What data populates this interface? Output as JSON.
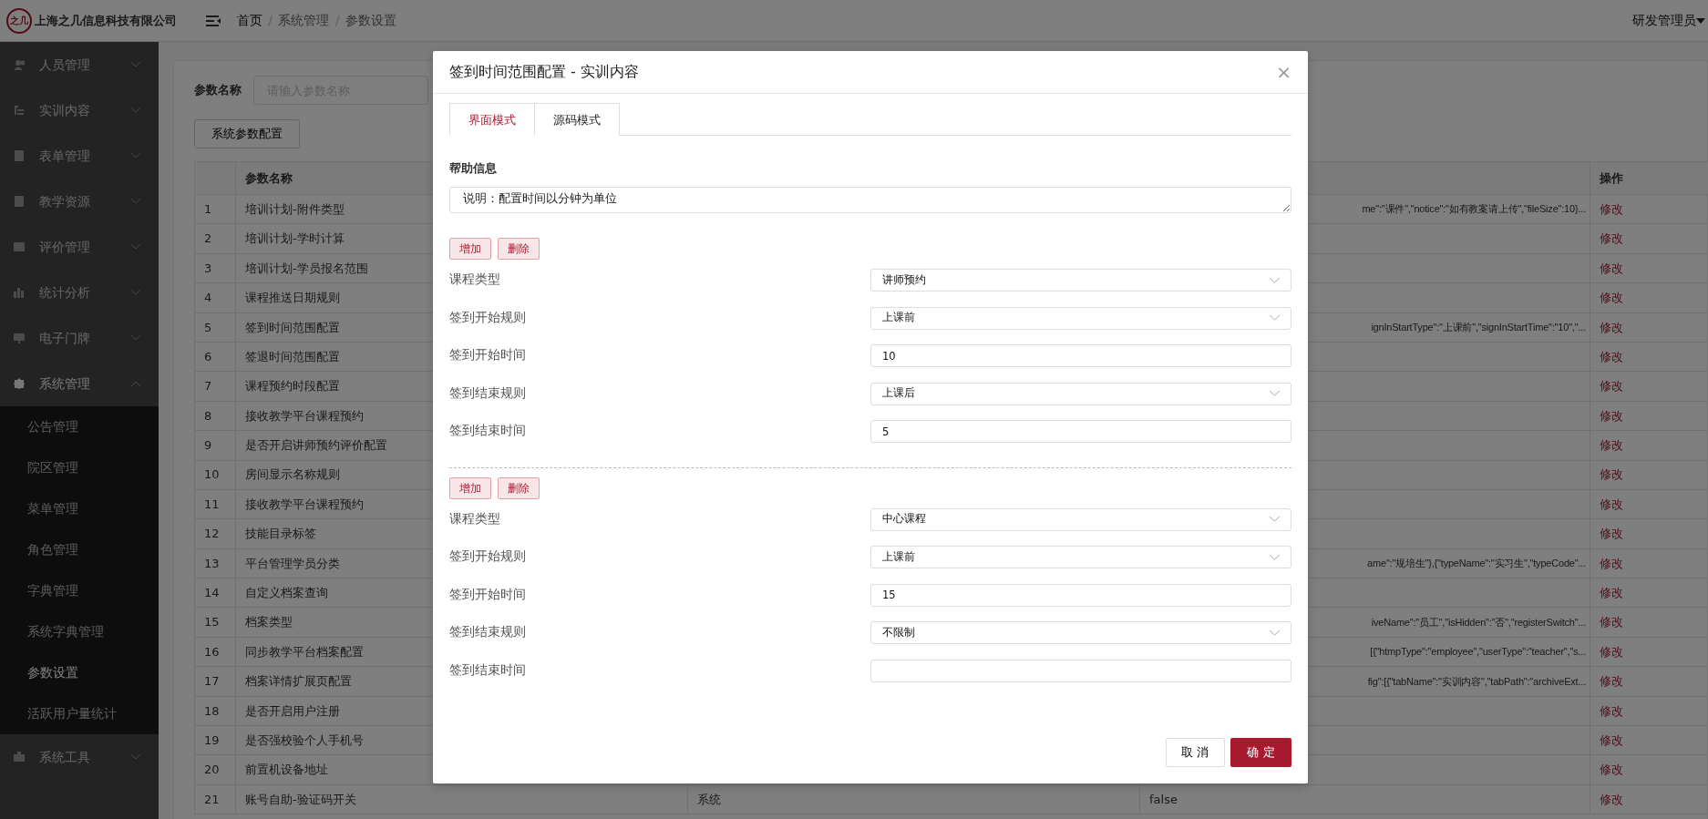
{
  "header": {
    "logo_text": "之几",
    "company": "上海之几信息科技有限公司",
    "breadcrumb": [
      {
        "kind": "link",
        "text": "首页"
      },
      {
        "kind": "separator",
        "text": "/"
      },
      {
        "kind": "link",
        "text": "系统管理"
      },
      {
        "kind": "separator",
        "text": "/"
      },
      {
        "kind": "link",
        "text": "参数设置"
      }
    ],
    "user": "研发管理员"
  },
  "sidebar": {
    "items": [
      {
        "label": "人员管理",
        "expanded": false
      },
      {
        "label": "实训内容",
        "expanded": false
      },
      {
        "label": "表单管理",
        "expanded": false
      },
      {
        "label": "教学资源",
        "expanded": false
      },
      {
        "label": "评价管理",
        "expanded": false
      },
      {
        "label": "统计分析",
        "expanded": false
      },
      {
        "label": "电子门牌",
        "expanded": false
      },
      {
        "label": "系统管理",
        "expanded": true,
        "children": [
          {
            "label": "公告管理",
            "selected": false
          },
          {
            "label": "院区管理",
            "selected": false
          },
          {
            "label": "菜单管理",
            "selected": false
          },
          {
            "label": "角色管理",
            "selected": false
          },
          {
            "label": "字典管理",
            "selected": false
          },
          {
            "label": "系统字典管理",
            "selected": false
          },
          {
            "label": "参数设置",
            "selected": true
          },
          {
            "label": "活跃用户量统计",
            "selected": false
          }
        ]
      },
      {
        "label": "系统工具",
        "expanded": false
      }
    ]
  },
  "search": {
    "label": "参数名称",
    "placeholder": "请输入参数名称"
  },
  "config_button": "系统参数配置",
  "table": {
    "column_2": "参数名称",
    "column_5": "操作",
    "rows": [
      {
        "index": "1",
        "name": "培训计划-附件类型",
        "column_4": "me\":\"课件\",\"notice\":\"如有教案请上传\",\"fileSize\":10}...",
        "clipped": true,
        "action": "修改"
      },
      {
        "index": "2",
        "name": "培训计划-学时计算",
        "action": "修改"
      },
      {
        "index": "3",
        "name": "培训计划-学员报名范围",
        "action": "修改"
      },
      {
        "index": "4",
        "name": "课程推送日期规则",
        "action": "修改"
      },
      {
        "index": "5",
        "name": "签到时间范围配置",
        "column_4": "ignInStartType\":\"上课前\",\"signInStartTime\":\"10\",\"...",
        "clipped": true,
        "action": "修改"
      },
      {
        "index": "6",
        "name": "签退时间范围配置",
        "action": "修改"
      },
      {
        "index": "7",
        "name": "课程预约时段配置",
        "action": "修改"
      },
      {
        "index": "8",
        "name": "接收教学平台课程预约",
        "action": "修改"
      },
      {
        "index": "9",
        "name": "是否开启讲师预约评价配置",
        "action": "修改"
      },
      {
        "index": "10",
        "name": "房间显示名称规则",
        "action": "修改"
      },
      {
        "index": "11",
        "name": "接收教学平台课程预约",
        "action": "修改"
      },
      {
        "index": "12",
        "name": "技能目录标签",
        "action": "修改"
      },
      {
        "index": "13",
        "name": "平台管理学员分类",
        "column_4": "ame\":\"规培生\"},{\"typeName\":\"实习生\",\"typeCode\"...",
        "clipped": true,
        "action": "修改"
      },
      {
        "index": "14",
        "name": "自定义档案查询",
        "action": "修改"
      },
      {
        "index": "15",
        "name": "档案类型",
        "column_4": "iveName\":\"员工\",\"isHidden\":\"否\",\"registerSwitch\"...",
        "clipped": true,
        "action": "修改"
      },
      {
        "index": "16",
        "name": "同步教学平台档案配置",
        "column_4": "[{\"htmpType\":\"employee\",\"userType\":\"teacher\",\"s...",
        "clipped": true,
        "action": "修改"
      },
      {
        "index": "17",
        "name": "档案详情扩展页配置",
        "column_4": "fig\":[{\"tabName\":\"实训内容\",\"tabPath\":\"archiveExt...",
        "clipped": true,
        "action": "修改"
      },
      {
        "index": "18",
        "name": "是否开启用户注册",
        "action": "修改"
      },
      {
        "index": "19",
        "name": "是否强校验个人手机号",
        "action": "修改"
      },
      {
        "index": "20",
        "name": "前置机设备地址",
        "action": "修改"
      },
      {
        "index": "21",
        "name": "账号自助-验证码开关",
        "column_3": "系统",
        "column_4": "false",
        "clipped": false,
        "action": "修改"
      }
    ]
  },
  "modal": {
    "title": "签到时间范围配置 - 实训内容",
    "close": "×",
    "tabs": [
      {
        "label": "界面模式",
        "selected": true
      },
      {
        "label": "源码模式",
        "selected": false
      }
    ],
    "help_label": "帮助信息",
    "help_text": "说明：配置时间以分钟为单位",
    "groups": [
      {
        "add": "增加",
        "delete": "删除",
        "fields": [
          {
            "label": "课程类型",
            "kind": "select",
            "value": "讲师预约"
          },
          {
            "label": "签到开始规则",
            "kind": "select",
            "value": "上课前"
          },
          {
            "label": "签到开始时间",
            "kind": "input",
            "value": "10"
          },
          {
            "label": "签到结束规则",
            "kind": "select",
            "value": "上课后"
          },
          {
            "label": "签到结束时间",
            "kind": "input",
            "value": "5"
          }
        ]
      },
      {
        "add": "增加",
        "delete": "删除",
        "fields": [
          {
            "label": "课程类型",
            "kind": "select",
            "value": "中心课程"
          },
          {
            "label": "签到开始规则",
            "kind": "select",
            "value": "上课前"
          },
          {
            "label": "签到开始时间",
            "kind": "input",
            "value": "15"
          },
          {
            "label": "签到结束规则",
            "kind": "select",
            "value": "不限制"
          },
          {
            "label": "签到结束时间",
            "kind": "input"
          }
        ]
      }
    ],
    "cancel": "取 消",
    "confirm": "确 定"
  }
}
